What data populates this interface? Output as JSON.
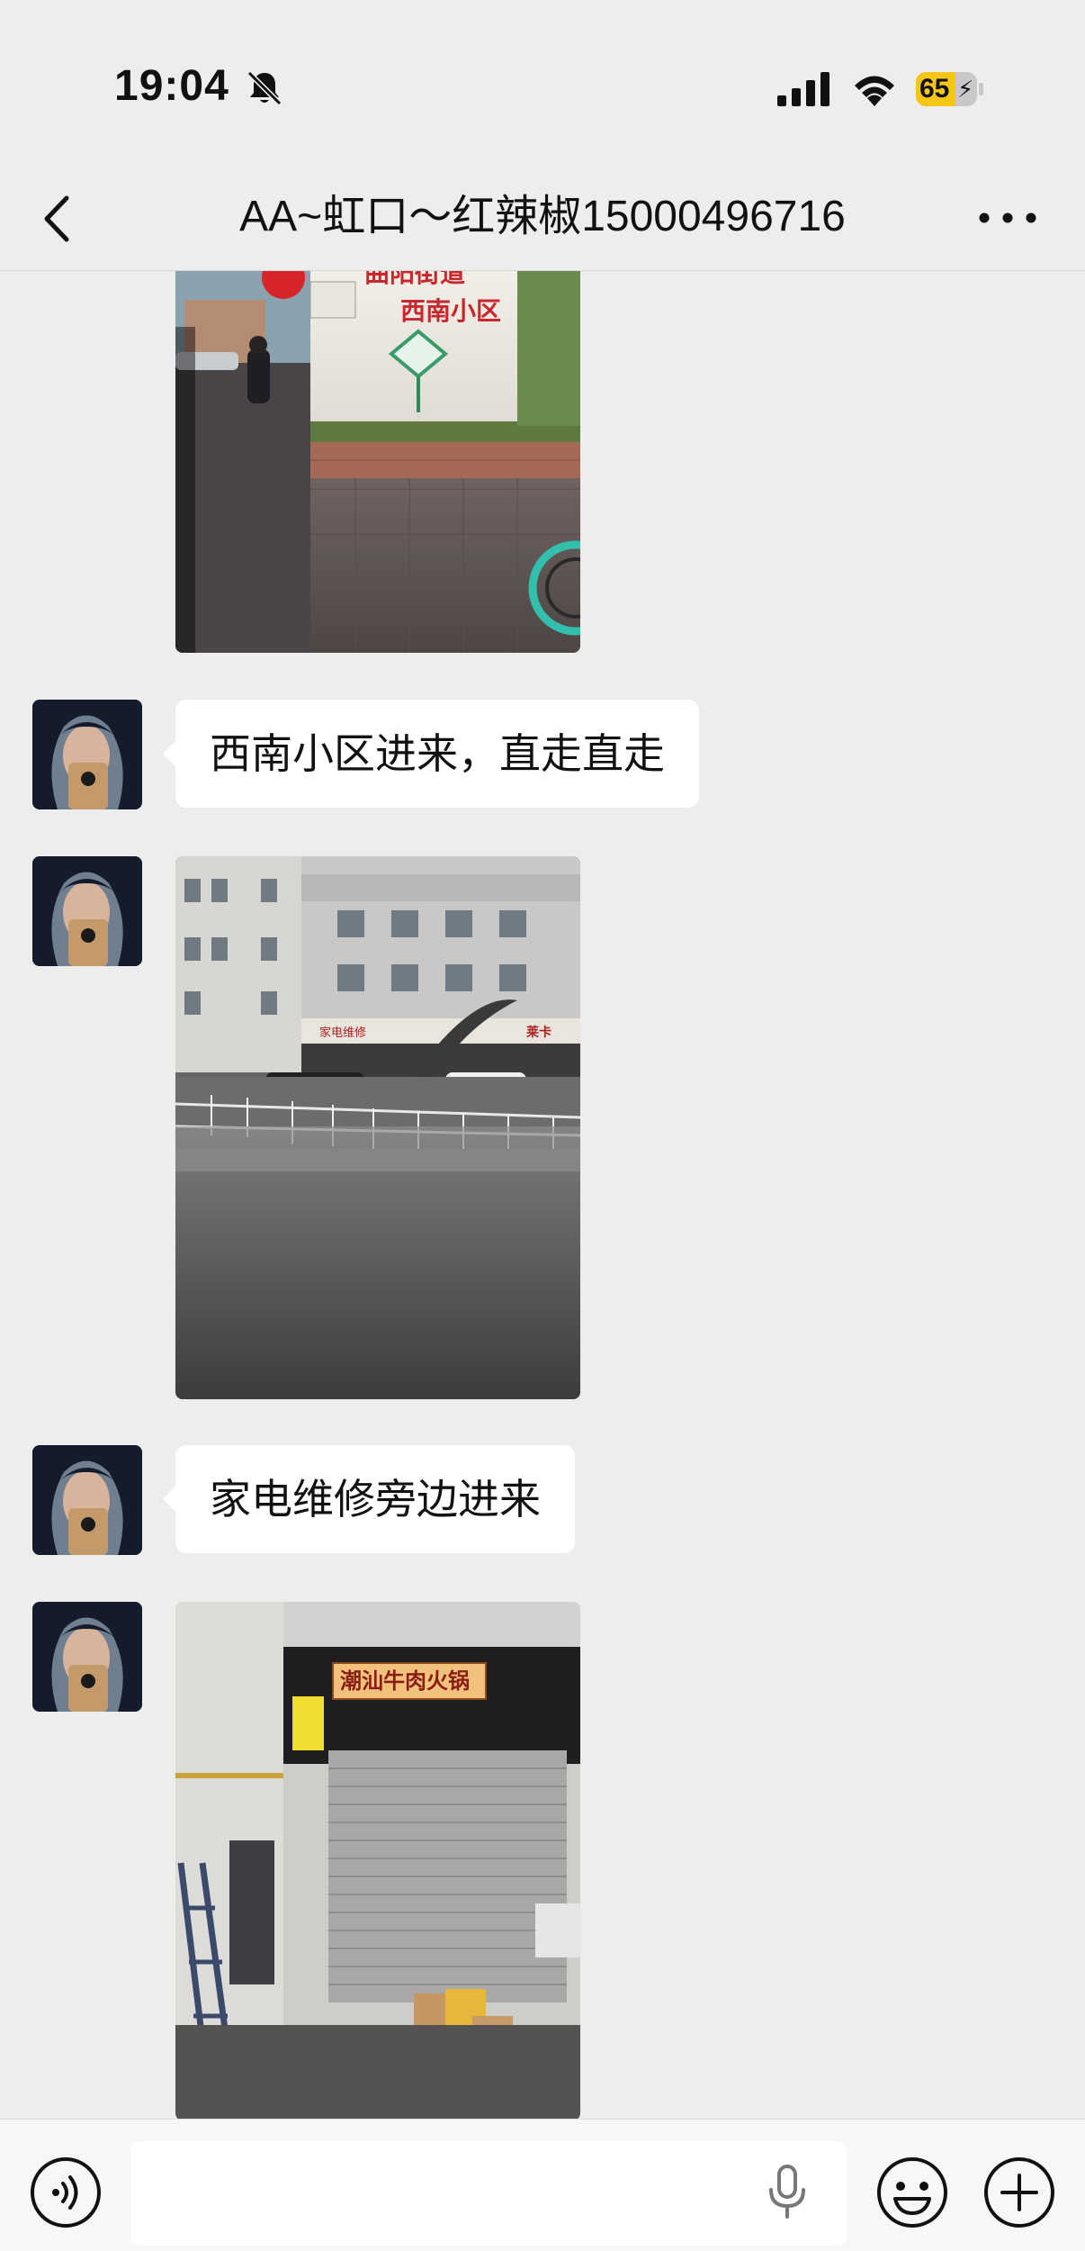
{
  "status_bar": {
    "time": "19:04",
    "battery_level": "65",
    "icons": [
      "bell-slash-icon",
      "signal-icon",
      "wifi-icon",
      "battery-icon"
    ]
  },
  "nav": {
    "title": "AA~虹口～红辣椒15000496716",
    "back_icon": "chevron-left-icon",
    "more_icon": "more-dots-icon"
  },
  "messages": [
    {
      "type": "image",
      "subject": "street-sign",
      "caption": "曲阳街道 西南小区"
    },
    {
      "type": "text",
      "text": "西南小区进来，直走直走"
    },
    {
      "type": "image",
      "subject": "street-corner",
      "caption": ""
    },
    {
      "type": "text",
      "text": "家电维修旁边进来"
    },
    {
      "type": "image",
      "subject": "shop-front",
      "caption": "潮汕牛肉火锅"
    }
  ],
  "input_bar": {
    "input_value": "",
    "icons": [
      "voice-icon",
      "mic-icon",
      "emoji-icon",
      "plus-icon"
    ]
  },
  "colors": {
    "background": "#ededed",
    "bubble": "#ffffff",
    "battery": "#f5c518"
  }
}
